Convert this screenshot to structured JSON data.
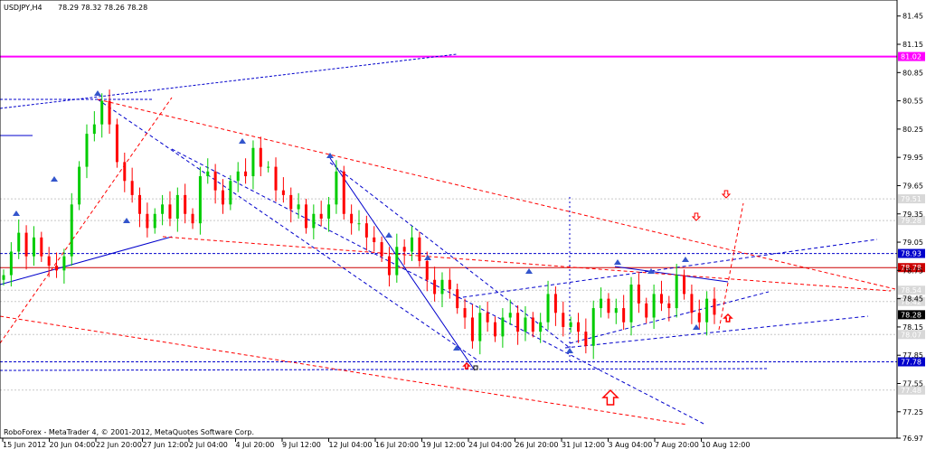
{
  "chart_data": {
    "type": "candlestick",
    "symbol": "USDJPY,H4",
    "ohlc_readout": "78.29 78.32 78.26 78.28",
    "footer": "RoboForex - MetaTrader 4, © 2001-2012, MetaQuotes Software Corp.",
    "ylim": [
      76.97,
      81.62
    ],
    "y_ticks": [
      "81.45",
      "81.15",
      "80.85",
      "80.55",
      "80.25",
      "79.95",
      "79.65",
      "79.35",
      "79.05",
      "78.75",
      "78.45",
      "78.15",
      "77.85",
      "77.55",
      "77.25",
      "76.97"
    ],
    "x_ticks": [
      "15 Jun 2012",
      "20 Jun 04:00",
      "22 Jun 20:00",
      "27 Jun 12:00",
      "2 Jul 04:00",
      "4 Jul 20:00",
      "9 Jul 12:00",
      "12 Jul 04:00",
      "16 Jul 20:00",
      "19 Jul 12:00",
      "24 Jul 04:00",
      "26 Jul 20:00",
      "31 Jul 12:00",
      "3 Aug 04:00",
      "7 Aug 20:00",
      "10 Aug 12:00"
    ],
    "price_levels": [
      {
        "value": "81.02",
        "label": "81.02",
        "color": "#ff00ff"
      },
      {
        "value": "79.51",
        "label": "79.51",
        "color": "#c0c0c0"
      },
      {
        "value": "79.28",
        "label": "79.28",
        "color": "#c0c0c0"
      },
      {
        "value": "78.93",
        "label": "78.93",
        "color": "#0000cc"
      },
      {
        "value": "78.78",
        "label": "78.78",
        "color": "#cc0000"
      },
      {
        "value": "78.54",
        "label": "78.54",
        "color": "#c0c0c0"
      },
      {
        "value": "78.42",
        "label": "78.42",
        "color": "#c0c0c0"
      },
      {
        "value": "78.28",
        "label": "78.28",
        "color": "#000000"
      },
      {
        "value": "78.07",
        "label": "78.07",
        "color": "#c0c0c0"
      },
      {
        "value": "77.78",
        "label": "77.78",
        "color": "#0000cc"
      },
      {
        "value": "77.48",
        "label": "77.48",
        "color": "#c0c0c0"
      }
    ],
    "close_path": [
      78.7,
      78.95,
      79.15,
      78.9,
      79.1,
      78.9,
      78.8,
      78.75,
      78.9,
      79.45,
      79.85,
      80.2,
      80.3,
      80.55,
      80.3,
      79.9,
      79.7,
      79.55,
      79.35,
      79.2,
      79.35,
      79.45,
      79.3,
      79.55,
      79.35,
      79.25,
      79.75,
      79.8,
      79.6,
      79.45,
      79.7,
      79.8,
      79.75,
      80.05,
      79.85,
      79.85,
      79.6,
      79.55,
      79.4,
      79.45,
      79.2,
      79.35,
      79.3,
      79.45,
      79.8,
      79.35,
      79.25,
      79.25,
      79.1,
      79.05,
      78.9,
      78.7,
      79.0,
      78.95,
      79.1,
      78.85,
      78.65,
      78.5,
      78.65,
      78.55,
      78.35,
      78.25,
      78.0,
      78.3,
      78.2,
      78.05,
      78.25,
      78.3,
      78.1,
      78.25,
      78.1,
      78.2,
      78.5,
      78.3,
      78.15,
      78.2,
      78.1,
      77.95,
      78.35,
      78.45,
      78.3,
      78.35,
      78.2,
      78.6,
      78.4,
      78.25,
      78.5,
      78.4,
      78.35,
      78.7,
      78.5,
      78.3,
      78.2,
      78.45,
      78.28
    ],
    "colors": {
      "bull": "#00cc00",
      "bear": "#ff0000",
      "blue_line": "#0000cc",
      "red_line": "#ff0000",
      "magenta": "#ff00ff",
      "grid": "#c0c0c0"
    }
  }
}
